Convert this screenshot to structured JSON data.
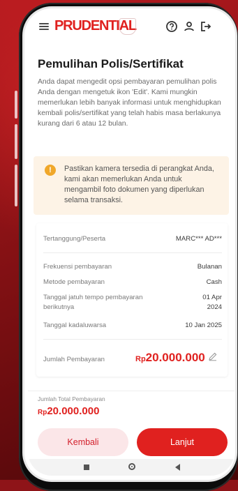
{
  "header": {
    "logo": "PRUDENTIAL",
    "icons": [
      "menu-icon",
      "help-icon",
      "user-icon",
      "logout-icon"
    ]
  },
  "page": {
    "title": "Pemulihan Polis/Sertifikat",
    "intro": "Anda dapat mengedit opsi pembayaran pemulihan polis Anda dengan mengetuk ikon 'Edit'. Kami mungkin memerlukan lebih banyak informasi untuk menghidupkan kembali polis/sertifikat yang telah habis masa berlakunya kurang dari 6 atau 12 bulan."
  },
  "notice": {
    "icon": "!",
    "text": "Pastikan kamera tersedia di perangkat Anda, kami akan memerlukan Anda untuk mengambil foto dokumen yang diperlukan selama transaksi."
  },
  "details": {
    "insured_label": "Tertanggung/Peserta",
    "insured_value": "MARC*** AD***",
    "frequency_label": "Frekuensi pembayaran",
    "frequency_value": "Bulanan",
    "method_label": "Metode pembayaran",
    "method_value": "Cash",
    "due_label": "Tanggal jatuh tempo pembayaran berikutnya",
    "due_value_line1": "01 Apr",
    "due_value_line2": "2024",
    "expiry_label": "Tanggal kadaluwarsa",
    "expiry_value": "10 Jan 2025",
    "payment_label": "Jumlah Pembayaran",
    "payment_currency": "Rp",
    "payment_amount": "20.000.000"
  },
  "footer": {
    "total_label": "Jumlah Total Pembayaran",
    "total_currency": "Rp",
    "total_amount": "20.000.000",
    "back_label": "Kembali",
    "next_label": "Lanjut"
  },
  "colors": {
    "brand": "#e0211f",
    "background": "#8e1418",
    "notice_bg": "#fdf3e6"
  }
}
